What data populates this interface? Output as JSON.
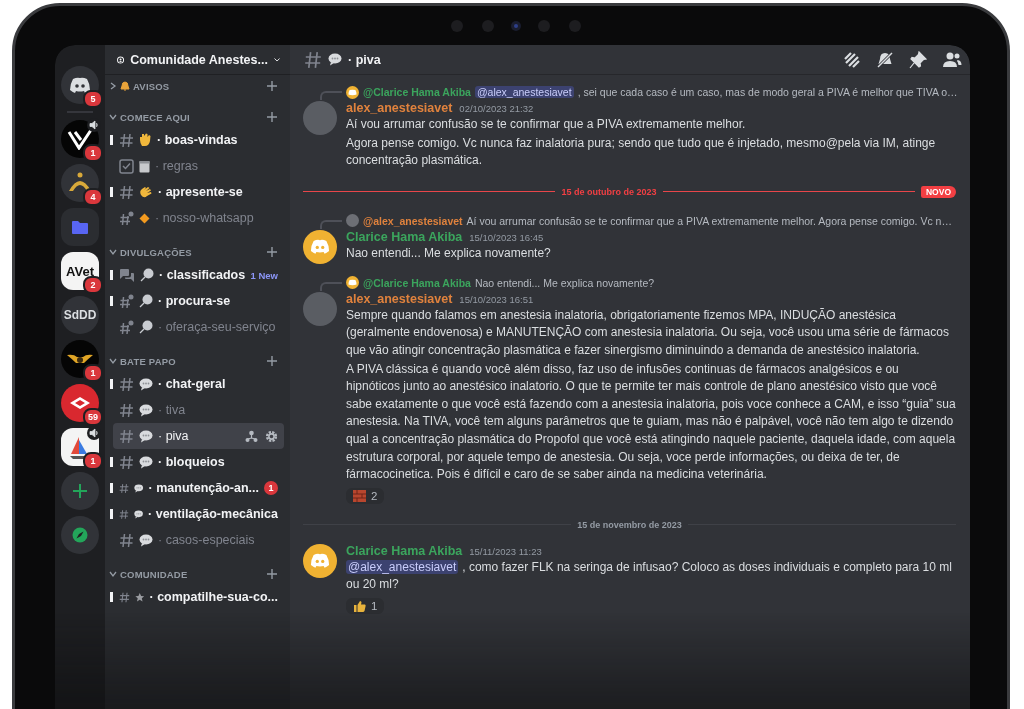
{
  "servers": [
    {
      "kind": "discord",
      "badge": "5",
      "audio": false
    },
    {
      "kind": "logo-v",
      "badge": "1",
      "audio": true
    },
    {
      "kind": "logo-arch",
      "badge": "4",
      "audio": false
    },
    {
      "kind": "folder",
      "audio": false
    },
    {
      "kind": "logo-avet",
      "label": "AVet",
      "badge": "2",
      "audio": false
    },
    {
      "kind": "text",
      "label": "SdDD",
      "audio": false
    },
    {
      "kind": "logo-wings",
      "badge": "1",
      "audio": false
    },
    {
      "kind": "logo-red",
      "badge": "59",
      "audio": false
    },
    {
      "kind": "logo-sail",
      "badge": "1",
      "audio": true
    },
    {
      "kind": "add",
      "audio": false
    },
    {
      "kind": "explore",
      "audio": false
    }
  ],
  "channel_list": {
    "server_name": "Comunidade Anestes...",
    "categories": [
      {
        "name": "AVISOS",
        "expanded": false
      },
      {
        "name": "COMECE AQUI",
        "expanded": true,
        "channels": [
          {
            "kind": "text",
            "name": "· boas-vindas",
            "unread": true,
            "selected": false
          },
          {
            "kind": "rules",
            "name": "· regras",
            "unread": false,
            "selected": false
          },
          {
            "kind": "text",
            "name": "· apresente-se",
            "unread": true,
            "selected": false
          },
          {
            "kind": "thread",
            "name": "· nosso-whatsapp",
            "unread": false,
            "selected": false
          }
        ]
      },
      {
        "name": "DIVULGAÇÕES",
        "expanded": true,
        "channels": [
          {
            "kind": "forum",
            "name": "· classificados",
            "unread": true,
            "selected": false,
            "new_badge": "1 New"
          },
          {
            "kind": "thread",
            "name": "· procura-se",
            "unread": true,
            "selected": false
          },
          {
            "kind": "thread",
            "name": "· oferaça-seu-serviço",
            "unread": false,
            "selected": false
          }
        ]
      },
      {
        "name": "BATE PAPO",
        "expanded": true,
        "channels": [
          {
            "kind": "text",
            "name": "· chat-geral",
            "unread": true,
            "selected": false
          },
          {
            "kind": "text",
            "name": "· tiva",
            "unread": false,
            "selected": false
          },
          {
            "kind": "text",
            "name": "· piva",
            "unread": false,
            "selected": true
          },
          {
            "kind": "text",
            "name": "· bloqueios",
            "unread": true,
            "selected": false
          },
          {
            "kind": "text",
            "name": "· manutenção-an...",
            "unread": true,
            "selected": false,
            "mentions": "1"
          },
          {
            "kind": "text",
            "name": "· ventilação-mecânica",
            "unread": true,
            "selected": false
          },
          {
            "kind": "text",
            "name": "· casos-especiais",
            "unread": false,
            "selected": false
          }
        ]
      },
      {
        "name": "COMUNIDADE",
        "expanded": true,
        "channels": [
          {
            "kind": "text",
            "name": "· compatilhe-sua-co...",
            "unread": true,
            "selected": false
          }
        ]
      }
    ]
  },
  "chat": {
    "channel": {
      "name": "· piva"
    },
    "messages": [
      {
        "kind": "message",
        "reply": {
          "avatar": {
            "kind": "discord"
          },
          "author": "@Clarice Hama Akiba",
          "color": "#3ba55d",
          "mention": "@alex_anestesiavet",
          "text": ", sei que cada caso é um caso, mas de modo geral a PIVA é melhor que TIVA o…"
        },
        "avatar": {
          "kind": "photo"
        },
        "author": "alex_anestesiavet",
        "color": "#e0823d",
        "time": "02/10/2023 21:32",
        "paragraphs": [
          "Aí vou arrumar confusão se te confirmar que a PIVA extremamente melhor.",
          "Agora pense comigo. Vc nunca faz inalatoria pura; sendo que tudo que é injetado, mesmo@pela via IM, atinge concentração plasmática."
        ]
      },
      {
        "kind": "divider",
        "date": "15 de outubro de 2023",
        "new": true,
        "badge": "NOVO"
      },
      {
        "kind": "message",
        "reply": {
          "avatar": {
            "kind": "photo"
          },
          "author": "@alex_anestesiavet",
          "color": "#e0823d",
          "text": "Aí vou arrumar confusão se te confirmar que a PIVA extremamente melhor. Agora pense comigo. Vc n…"
        },
        "avatar": {
          "kind": "discord"
        },
        "author": "Clarice Hama Akiba",
        "color": "#3ba55d",
        "time": "15/10/2023 16:45",
        "paragraphs": [
          "Nao entendi... Me explica novamente?"
        ]
      },
      {
        "kind": "message",
        "reply": {
          "avatar": {
            "kind": "discord"
          },
          "author": "@Clarice Hama Akiba",
          "color": "#3ba55d",
          "text": "Nao entendi... Me explica novamente?"
        },
        "avatar": {
          "kind": "photo"
        },
        "author": "alex_anestesiavet",
        "color": "#e0823d",
        "time": "15/10/2023 16:51",
        "paragraphs": [
          "Sempre quando falamos em anestesia inalatoria, obrigatoriamente fizemos MPA, INDUÇÃO anestésica (geralmente endovenosa) e MANUTENÇÃO com anestesia inalatoria. Ou seja, você usou uma série de fármacos que vão atingir concentração plasmática e fazer sinergismo diminuindo a demanda de anestésico inalatoria.",
          "A PIVA clássica é quando você além disso, faz uso de infusões continuas de fármacos analgésicos e ou hipnóticos junto ao anestésico inalatorio. O que te permite ter mais controle de plano anestésico visto que você sabe exatamente o que você está fazendo com a anestesia inalatoria, pois voce conhece a CAM, e isso “guia” sua anestesia. Na TIVA, você tem alguns parâmetros que te guiam, mas não é palpável, você não tem algo te dizendo qual a concentração plasmática do Propofol que você está atingindo naquele paciente, daquela idade, com aquela estrutura corporal, por aquele tempo de anestesia. Ou seja, voce perde informações, ou deixa de ter, de fármacocinetica. Pois é difícil e caro de se saber ainda na medicina veterinária."
        ],
        "reactions": [
          {
            "kind": "brick",
            "count": "2"
          }
        ]
      },
      {
        "kind": "divider",
        "date": "15 de novembro de 2023",
        "new": false
      },
      {
        "kind": "message",
        "avatar": {
          "kind": "discord"
        },
        "author": "Clarice Hama Akiba",
        "color": "#3ba55d",
        "time": "15/11/2023 11:23",
        "mention": "@alex_anestesiavet",
        "paragraphs": [
          ", como fazer FLK na seringa de infusao? Coloco as doses individuais e completo para 10 ml ou 20 ml?"
        ],
        "reactions": [
          {
            "kind": "thumbs-up",
            "count": "1"
          }
        ]
      }
    ]
  }
}
